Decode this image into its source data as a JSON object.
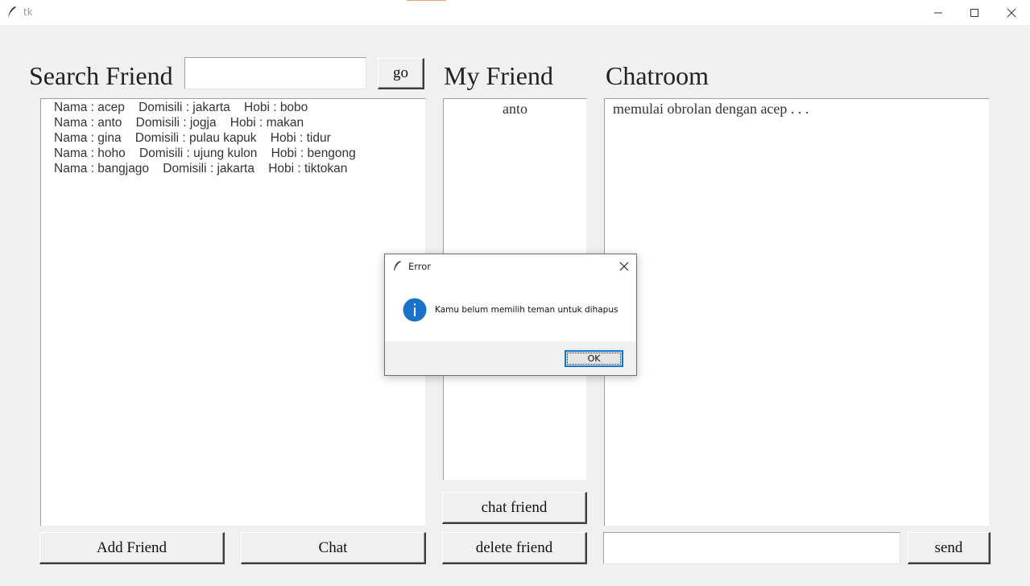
{
  "window": {
    "title": "tk"
  },
  "search": {
    "heading": "Search Friend",
    "input_value": "",
    "go_label": "go"
  },
  "users_list": [
    {
      "text": "Nama : acep    Domisili : jakarta    Hobi : bobo"
    },
    {
      "text": "Nama : anto    Domisili : jogja    Hobi : makan"
    },
    {
      "text": "Nama : gina    Domisili : pulau kapuk    Hobi : tidur"
    },
    {
      "text": "Nama : hoho    Domisili : ujung kulon    Hobi : bengong"
    },
    {
      "text": "Nama : bangjago    Domisili : jakarta    Hobi : tiktokan"
    }
  ],
  "my_friend": {
    "heading": "My Friend",
    "items": [
      "anto"
    ]
  },
  "chatroom": {
    "heading": "Chatroom",
    "lines": [
      "memulai obrolan dengan acep . . ."
    ],
    "input_value": ""
  },
  "buttons": {
    "add_friend": "Add Friend",
    "chat": "Chat",
    "chat_friend": "chat friend",
    "delete_friend": "delete friend",
    "send": "send"
  },
  "dialog": {
    "title": "Error",
    "message": "Kamu belum memilih teman untuk dihapus",
    "ok_label": "OK"
  },
  "colors": {
    "background": "#f0f0f0",
    "info_blue": "#1a73c9",
    "focus_border": "#0078d7"
  }
}
